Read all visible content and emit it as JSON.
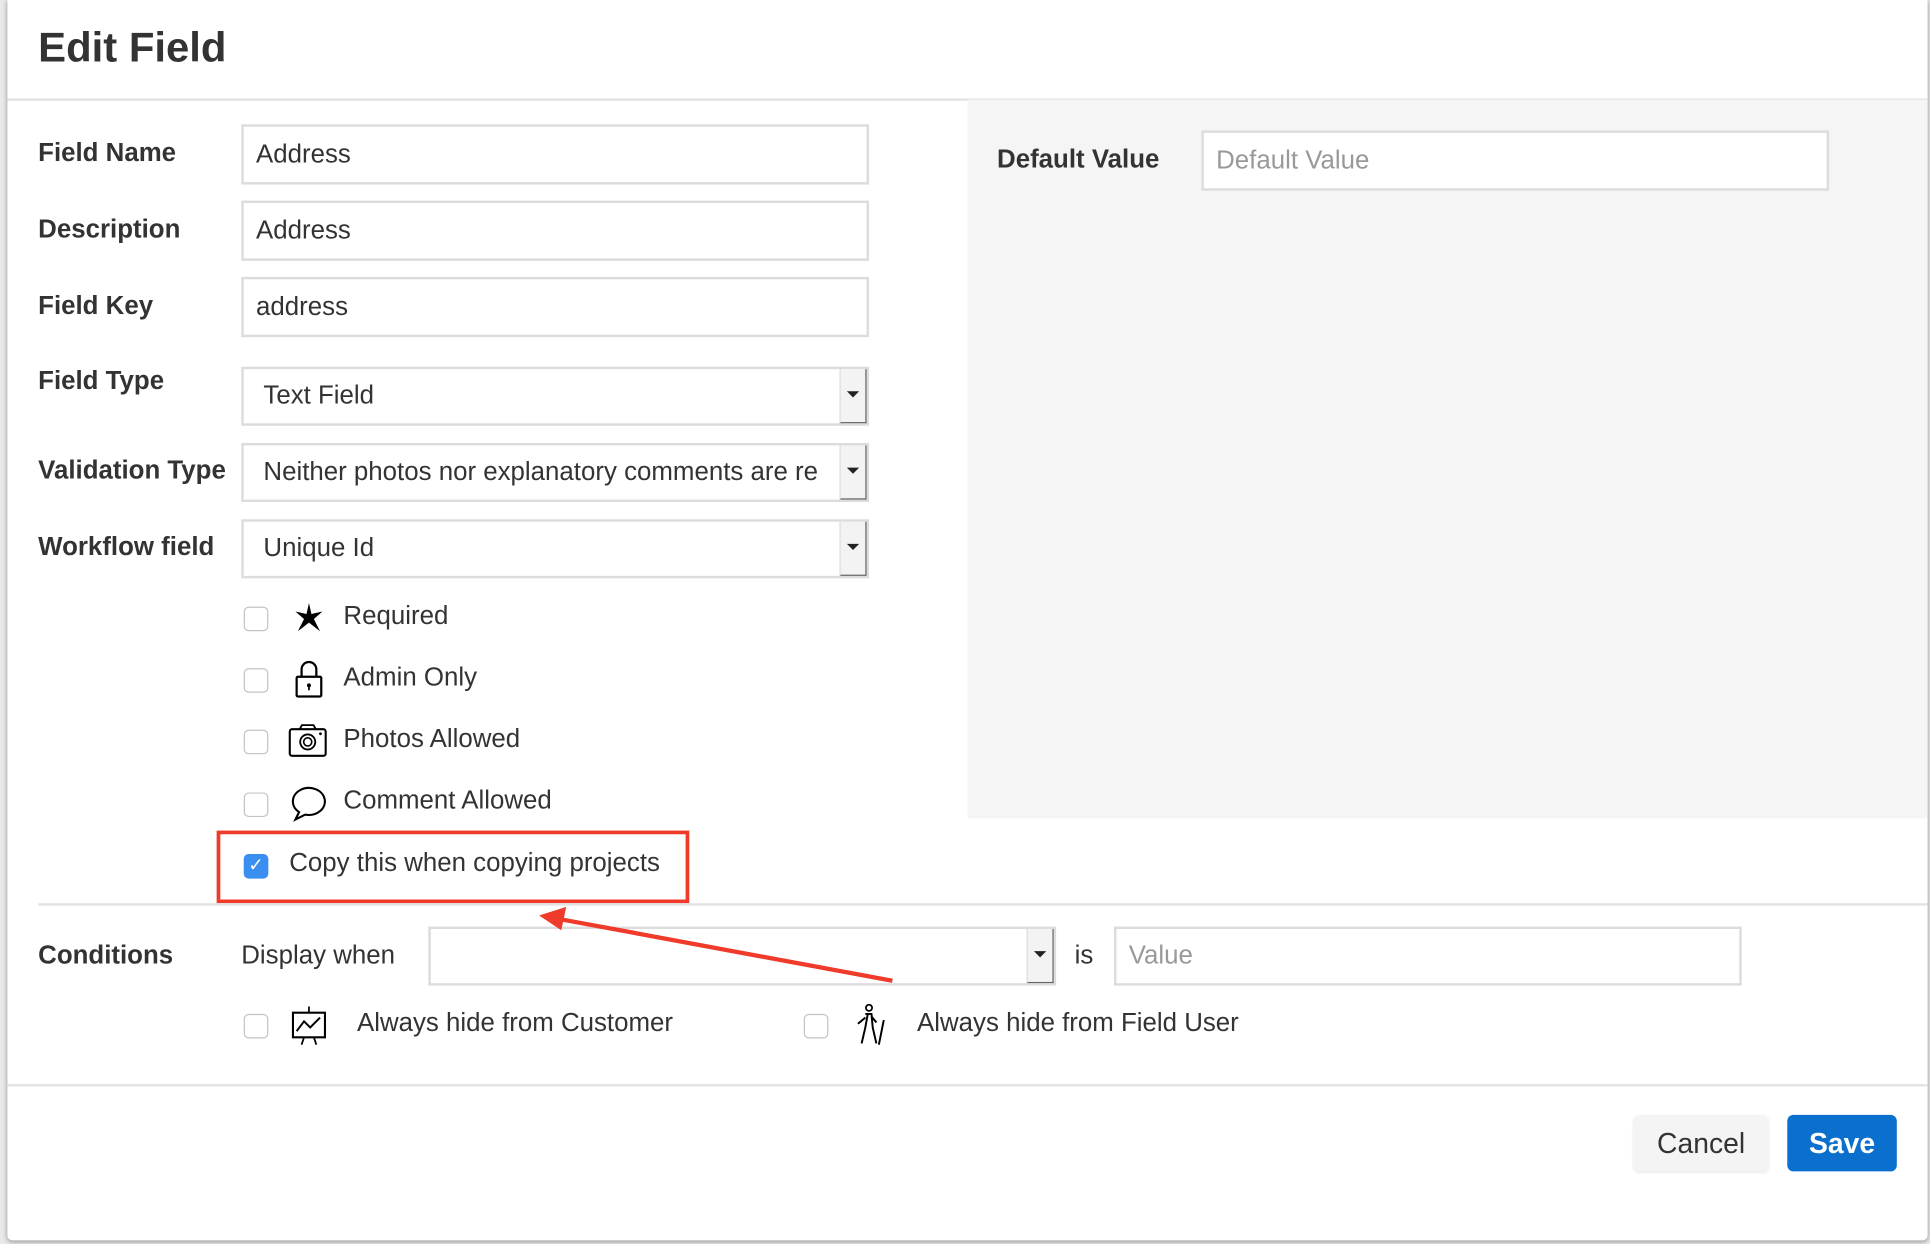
{
  "dialog": {
    "title": "Edit Field"
  },
  "form": {
    "field_name": {
      "label": "Field Name",
      "value": "Address"
    },
    "description": {
      "label": "Description",
      "value": "Address"
    },
    "field_key": {
      "label": "Field Key",
      "value": "address"
    },
    "field_type": {
      "label": "Field Type",
      "value": "Text Field"
    },
    "validation_type": {
      "label": "Validation Type",
      "value": "Neither photos nor explanatory comments are re"
    },
    "workflow_field": {
      "label": "Workflow field",
      "value": "Unique Id"
    },
    "default_value": {
      "label": "Default Value",
      "placeholder": "Default Value",
      "value": ""
    }
  },
  "options": [
    {
      "label": "Required",
      "icon": "asterisk-icon",
      "checked": false
    },
    {
      "label": "Admin Only",
      "icon": "lock-icon",
      "checked": false
    },
    {
      "label": "Photos Allowed",
      "icon": "camera-icon",
      "checked": false
    },
    {
      "label": "Comment Allowed",
      "icon": "comment-icon",
      "checked": false
    }
  ],
  "copy_option": {
    "label": "Copy this when copying projects",
    "checked": true
  },
  "conditions": {
    "label": "Conditions",
    "display_when": "Display when",
    "select_value": "",
    "is": "is",
    "value_placeholder": "Value",
    "hide_customer": {
      "label": "Always hide from Customer",
      "icon": "presentation-icon",
      "checked": false
    },
    "hide_field_user": {
      "label": "Always hide from Field User",
      "icon": "hiker-icon",
      "checked": false
    }
  },
  "footer": {
    "cancel": "Cancel",
    "save": "Save"
  },
  "colors": {
    "save": "#0b6fce",
    "annotation": "#f03a2a",
    "checkbox_on": "#3a8ef0"
  }
}
